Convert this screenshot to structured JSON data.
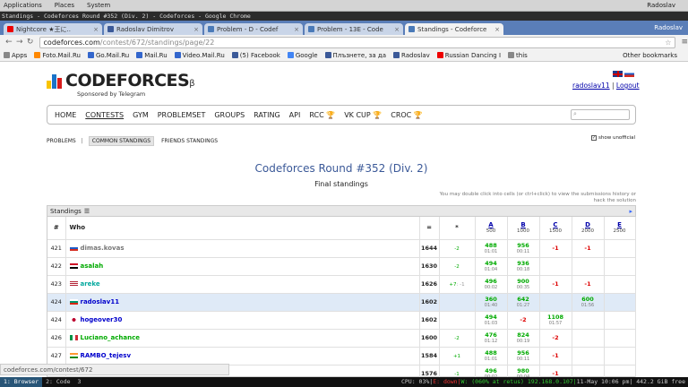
{
  "os": {
    "menu": [
      "Applications",
      "Places",
      "System"
    ],
    "user": "Radoslav"
  },
  "window_title": "Standings - Codeforces Round #352 (Div. 2) - Codeforces - Google Chrome",
  "tabs": [
    {
      "label": "Nightcore ★王に..",
      "color": "#e00"
    },
    {
      "label": "Radoslav Dimitrov",
      "color": "#3b5998"
    },
    {
      "label": "Problem - D - Codef",
      "color": "#4a7ab8"
    },
    {
      "label": "Problem - 13E - Code",
      "color": "#4a7ab8"
    },
    {
      "label": "Standings - Codeforce",
      "color": "#4a7ab8"
    }
  ],
  "address": {
    "host": "codeforces.com",
    "path": "/contest/672/standings/page/22"
  },
  "bookmarks": [
    {
      "label": "Apps",
      "color": "#888"
    },
    {
      "label": "Foto.Mail.Ru",
      "color": "#f80"
    },
    {
      "label": "Go.Mail.Ru",
      "color": "#36c"
    },
    {
      "label": "Mail.Ru",
      "color": "#36c"
    },
    {
      "label": "Video.Mail.Ru",
      "color": "#36c"
    },
    {
      "label": "(5) Facebook",
      "color": "#3b5998"
    },
    {
      "label": "Google",
      "color": "#4285f4"
    },
    {
      "label": "Плъзнете, за да",
      "color": "#3b5998"
    },
    {
      "label": "Radoslav",
      "color": "#3b5998"
    },
    {
      "label": "Russian Dancing I",
      "color": "#e00"
    },
    {
      "label": "this",
      "color": "#888"
    }
  ],
  "other_bookmarks": "Other bookmarks",
  "logo": {
    "name": "CODEFORCES",
    "beta": "β",
    "sponsor": "Sponsored by Telegram"
  },
  "user_links": {
    "user": "radoslav11",
    "sep": " | ",
    "logout": "Logout"
  },
  "menu": [
    "HOME",
    "CONTESTS",
    "GYM",
    "PROBLEMSET",
    "GROUPS",
    "RATING",
    "API",
    "RCC",
    "VK CUP",
    "CROC"
  ],
  "subnav": {
    "problems": "PROBLEMS",
    "sep": "|",
    "common": "COMMON STANDINGS",
    "friends": "FRIENDS STANDINGS"
  },
  "show_unofficial": "show unofficial",
  "contest_title": "Codeforces Round #352 (Div. 2)",
  "final": "Final standings",
  "hint": "You may double click into cells (or ctrl+click) to view the submissions history or hack the solution",
  "standings_label": "Standings",
  "columns": {
    "rank": "#",
    "who": "Who",
    "points": "=",
    "hacks": "*"
  },
  "problems": [
    {
      "letter": "A",
      "points": "500"
    },
    {
      "letter": "B",
      "points": "1000"
    },
    {
      "letter": "C",
      "points": "1500"
    },
    {
      "letter": "D",
      "points": "2000"
    },
    {
      "letter": "E",
      "points": "2500"
    }
  ],
  "rows": [
    {
      "rank": "421",
      "who": "dimas.kovas",
      "color": "#777",
      "flag": "ru",
      "pts": "1644",
      "hacks": "-2",
      "hneg": "",
      "A": [
        "488",
        "01:01"
      ],
      "B": [
        "956",
        "00:11"
      ],
      "C": "-1",
      "D": "-1",
      "E": ""
    },
    {
      "rank": "422",
      "who": "asalah",
      "color": "#0a0",
      "flag": "eg",
      "pts": "1630",
      "hacks": "-2",
      "hneg": "",
      "A": [
        "494",
        "01:04"
      ],
      "B": [
        "936",
        "00:18"
      ],
      "C": "",
      "D": "",
      "E": ""
    },
    {
      "rank": "423",
      "who": "areke",
      "color": "#03a89e",
      "flag": "us",
      "pts": "1626",
      "hacks": "+7",
      "hneg": ": -1",
      "A": [
        "496",
        "00:02"
      ],
      "B": [
        "900",
        "00:35"
      ],
      "C": "-1",
      "D": "-1",
      "E": ""
    },
    {
      "rank": "424",
      "who": "radoslav11",
      "color": "#00c",
      "flag": "bg",
      "pts": "1602",
      "hacks": "",
      "hneg": "",
      "A": [
        "360",
        "01:40"
      ],
      "B": [
        "642",
        "01:27"
      ],
      "C": "",
      "D": [
        "600",
        "01:56"
      ],
      "E": ""
    },
    {
      "rank": "424",
      "who": "hogeover30",
      "color": "#00c",
      "flag": "jp",
      "pts": "1602",
      "hacks": "",
      "hneg": "",
      "A": [
        "494",
        "01:03"
      ],
      "B": "-2",
      "C": [
        "1108",
        "01:57"
      ],
      "D": "",
      "E": ""
    },
    {
      "rank": "426",
      "who": "Luciano_achance",
      "color": "#0a0",
      "flag": "it",
      "pts": "1600",
      "hacks": "-2",
      "hneg": "",
      "A": [
        "476",
        "01:12"
      ],
      "B": [
        "824",
        "00:19"
      ],
      "C": "-2",
      "D": "",
      "E": ""
    },
    {
      "rank": "427",
      "who": "RAMBO_tejesv",
      "color": "#00c",
      "flag": "in",
      "pts": "1584",
      "hacks": "+1",
      "hneg": "",
      "A": [
        "488",
        "01:01"
      ],
      "B": [
        "956",
        "00:11"
      ],
      "C": "-1",
      "D": "",
      "E": ""
    },
    {
      "rank": "428",
      "who": "",
      "color": "#00c",
      "flag": "",
      "pts": "1576",
      "hacks": "-1",
      "hneg": "",
      "A": [
        "496",
        "00:02"
      ],
      "B": [
        "980",
        "00:04"
      ],
      "C": "-1",
      "D": "",
      "E": ""
    }
  ],
  "status_url": "codeforces.com/contest/672",
  "taskbar": {
    "ws1": "1: Browser",
    "ws2": "2: Code",
    "ws3": "3",
    "cpu": "CPU: 03%|",
    "e": "E: down|",
    "w": "W: (060% at retus) 192.168.0.107|",
    "date": "11-May 10:06 pm|",
    "mem": "442.2 GiB free"
  }
}
